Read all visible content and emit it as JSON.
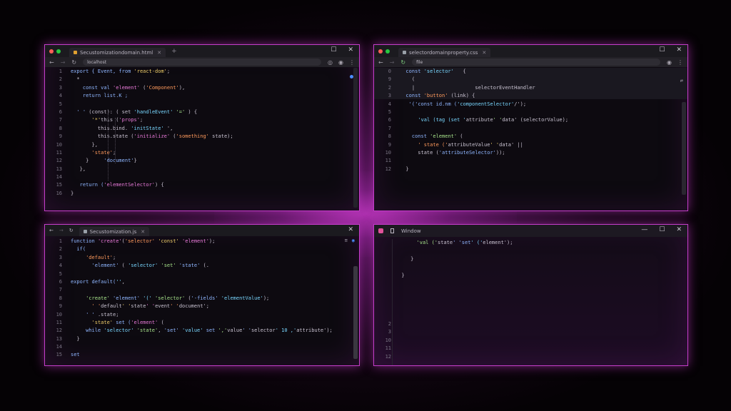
{
  "windows": [
    {
      "id": "top-left",
      "tab_title": "Secustomizationdomain.html",
      "url": "localhost",
      "gutter": [
        "1",
        "2",
        "3",
        "4",
        "5",
        "6",
        "7",
        "8",
        "9",
        "10",
        "11",
        "12",
        "13",
        "14",
        "15",
        "16"
      ],
      "code": [
        "export { Event, from 'react-dom';",
        "  *",
        "    const val 'element' ('Component'),",
        "    return list.K ;",
        "",
        "  ' ' (const): ( set 'handleEvent' '=' ) {",
        "       '*'this ('props';",
        "         this.bind. 'initState' ',",
        "         this.state ('initialize' ('something' state);",
        "       },",
        "       'state';",
        "     }     'document'}",
        "   },",
        "",
        "   return ('elementSelector') {",
        "}"
      ]
    },
    {
      "id": "top-right",
      "tab_title": "selectordomainproperty.css",
      "url": "file",
      "gutter": [
        "0",
        "9",
        "2",
        "3",
        "4",
        "5",
        "6",
        "7",
        "8",
        "9",
        "10",
        "11",
        "12"
      ],
      "code": [
        "  const 'selector'   {",
        "    (",
        "    |                    selectorEventHandler",
        "  const 'button' (link) {",
        "   '('const id.nm ('componentSelector'/');",
        "",
        "      'val (tag (set 'attribute' 'data' (selectorValue);",
        "",
        "    const 'element' (",
        "      ' state ('attributeValue' 'data' ||",
        "      state ('attributeSelector'));",
        "",
        "  }"
      ]
    },
    {
      "id": "bottom-left",
      "tab_title": "Secustomization.js",
      "gutter": [
        "1",
        "2",
        "3",
        "4",
        "5",
        "6",
        "7",
        "8",
        "9",
        "10",
        "11",
        "12",
        "13",
        "14",
        "15"
      ],
      "code": [
        "function 'create'('selector' 'const' 'element');",
        "  if(",
        "     'default';",
        "       'element' ( 'selector' 'set' 'state' (.",
        "",
        "export default('',",
        "",
        "     'create' 'element' '(' 'selector' ('-fields' 'elementValue');",
        "       ' 'default' 'state' 'event' 'document';",
        "     ' ' .state;",
        "       'state' set ('element' (",
        "     while 'selector' 'state', 'set' 'value' set ','value' 'selector' 10 ,'attribute');",
        "  }",
        "",
        "set"
      ]
    },
    {
      "id": "bottom-right",
      "tab_title": "Window",
      "gutter": [
        "2",
        "3",
        "10",
        "11",
        "12"
      ],
      "code": [
        "       'val ('state' 'set' ('element');",
        "",
        "     }",
        "",
        "  }"
      ]
    }
  ],
  "colors": {
    "accent_border": "#c43dc9",
    "background_glow": "#6b1a6e",
    "window_bg": "#0d0a10",
    "titlebar_bg": "#1b1a1f"
  },
  "icons": {
    "close": "✕",
    "maximize": "☐",
    "minimize": "—",
    "back": "←",
    "forward": "→",
    "reload": "↻",
    "more": "⋮",
    "plus": "+"
  }
}
